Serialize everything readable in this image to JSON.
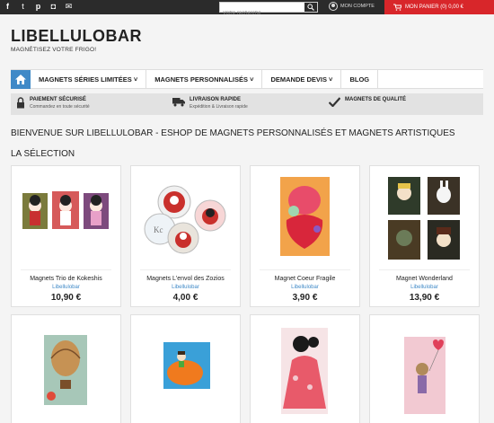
{
  "topbar": {
    "social": [
      {
        "icon": "facebook-icon",
        "glyph": "f"
      },
      {
        "icon": "twitter-icon",
        "glyph": "t"
      },
      {
        "icon": "pinterest-icon",
        "glyph": "p"
      },
      {
        "icon": "instagram-icon",
        "glyph": "◘"
      },
      {
        "icon": "email-icon",
        "glyph": "✉"
      }
    ],
    "search_placeholder": "Votre recherche",
    "account_label": "MON COMPTE",
    "cart_label": "MON PANIER (0) 0,00 €"
  },
  "header": {
    "logo": "LIBELLULOBAR",
    "tagline": "MAGNÉTISEZ VOTRE FRIGO!"
  },
  "nav": {
    "items": [
      "MAGNETS SÉRIES LIMITÉES ˅",
      "MAGNETS PERSONNALISÉS ˅",
      "DEMANDE DEVIS ˅",
      "BLOG"
    ]
  },
  "assurance": [
    {
      "icon": "lock-icon",
      "title": "PAIEMENT SÉCURISÉ",
      "subtitle": "Commandez en toute sécurité"
    },
    {
      "icon": "truck-icon",
      "title": "LIVRAISON RAPIDE",
      "subtitle": "Expédition & Livraison rapide"
    },
    {
      "icon": "check-icon",
      "title": "MAGNETS DE QUALITÉ",
      "subtitle": ""
    }
  ],
  "main": {
    "welcome": "BIENVENUE SUR LIBELLULOBAR - ESHOP DE MAGNETS PERSONNALISÉS ET MAGNETS ARTISTIQUES",
    "selection_title": "LA SÉLECTION",
    "products": [
      {
        "name": "Magnets Trio de Kokeshis",
        "brand": "Libellulobar",
        "price": "10,90 €"
      },
      {
        "name": "Magnets L'envol des Zozios",
        "brand": "Libellulobar",
        "price": "4,00 €"
      },
      {
        "name": "Magnet Coeur Fragile",
        "brand": "Libellulobar",
        "price": "3,90 €"
      },
      {
        "name": "Magnet Wonderland",
        "brand": "Libellulobar",
        "price": "13,90 €"
      },
      {
        "name": "",
        "brand": "",
        "price": ""
      },
      {
        "name": "",
        "brand": "",
        "price": ""
      },
      {
        "name": "",
        "brand": "",
        "price": ""
      },
      {
        "name": "",
        "brand": "",
        "price": ""
      }
    ]
  },
  "colors": {
    "accent": "#3f89c7",
    "cart": "#d8262a",
    "topbar": "#2b2b2b"
  }
}
